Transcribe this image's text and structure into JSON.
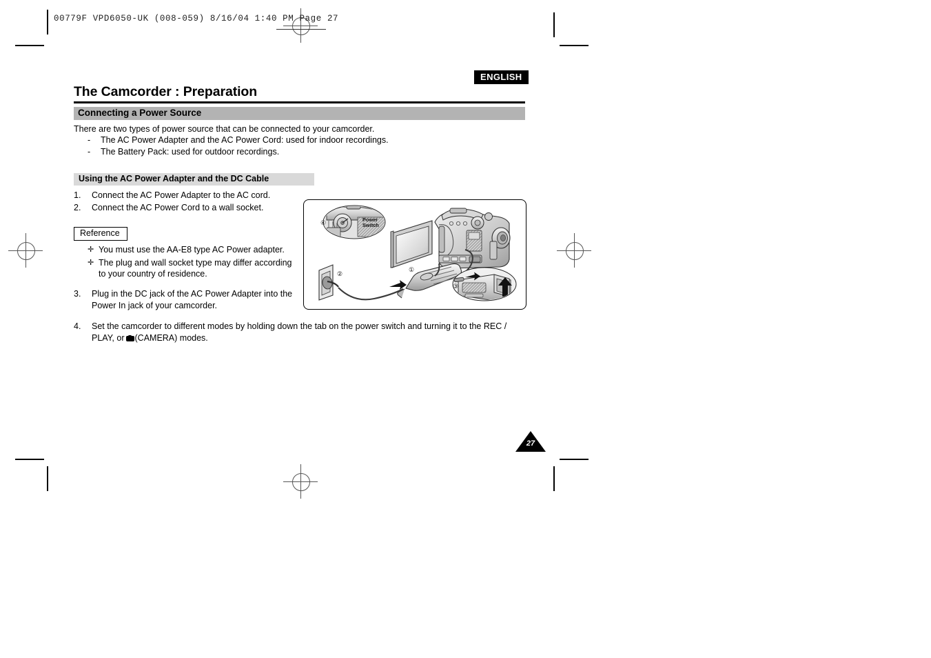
{
  "film_header": {
    "text": "00779F  VPD6050-UK  (008-059)   8/16/04 1:40 PM   Page 27"
  },
  "document": {
    "language_badge": "ENGLISH",
    "title": "The Camcorder : Preparation",
    "section_heading": "Connecting a Power Source",
    "intro": "There are two types of power source that can be connected to your camcorder.",
    "dash_items": [
      {
        "mark": "-",
        "text": "The AC Power Adapter and the AC Power Cord: used for indoor recordings."
      },
      {
        "mark": "-",
        "text": "The Battery Pack: used for outdoor recordings."
      }
    ],
    "subsection_heading": "Using the AC Power Adapter and the DC Cable",
    "steps": [
      {
        "index": "1.",
        "text": "Connect the AC Power Adapter to the AC cord."
      },
      {
        "index": "2.",
        "text": "Connect the AC Power Cord to a wall socket."
      }
    ],
    "reference": {
      "label": "Reference",
      "bullet_glyph": "✛",
      "items": [
        "You must use the AA-E8 type AC Power adapter.",
        "The plug and wall socket type may differ according to your country of residence."
      ]
    },
    "step3": {
      "index": "3.",
      "text": "Plug in the DC jack of the AC Power Adapter into the Power In jack of your camcorder."
    },
    "step4": {
      "index": "4.",
      "text_before": "Set the camcorder to different modes by holding down the tab on the power switch and turning it to the REC / PLAY, or",
      "camera_icon_name": "camera-mode-icon",
      "text_after": "(CAMERA) modes."
    },
    "page_number": "27"
  },
  "figure": {
    "caption_labels": {
      "callout_1": "①",
      "callout_2": "②",
      "callout_3": "③",
      "callout_4": "④"
    },
    "power_switch_label_line1": "Power",
    "power_switch_label_line2": "Switch"
  },
  "colors": {
    "section_bar": "#b3b3b3",
    "subsection_bar": "#d9d9d9",
    "badge_bg": "#000000",
    "badge_text": "#ffffff",
    "rule": "#000000"
  }
}
